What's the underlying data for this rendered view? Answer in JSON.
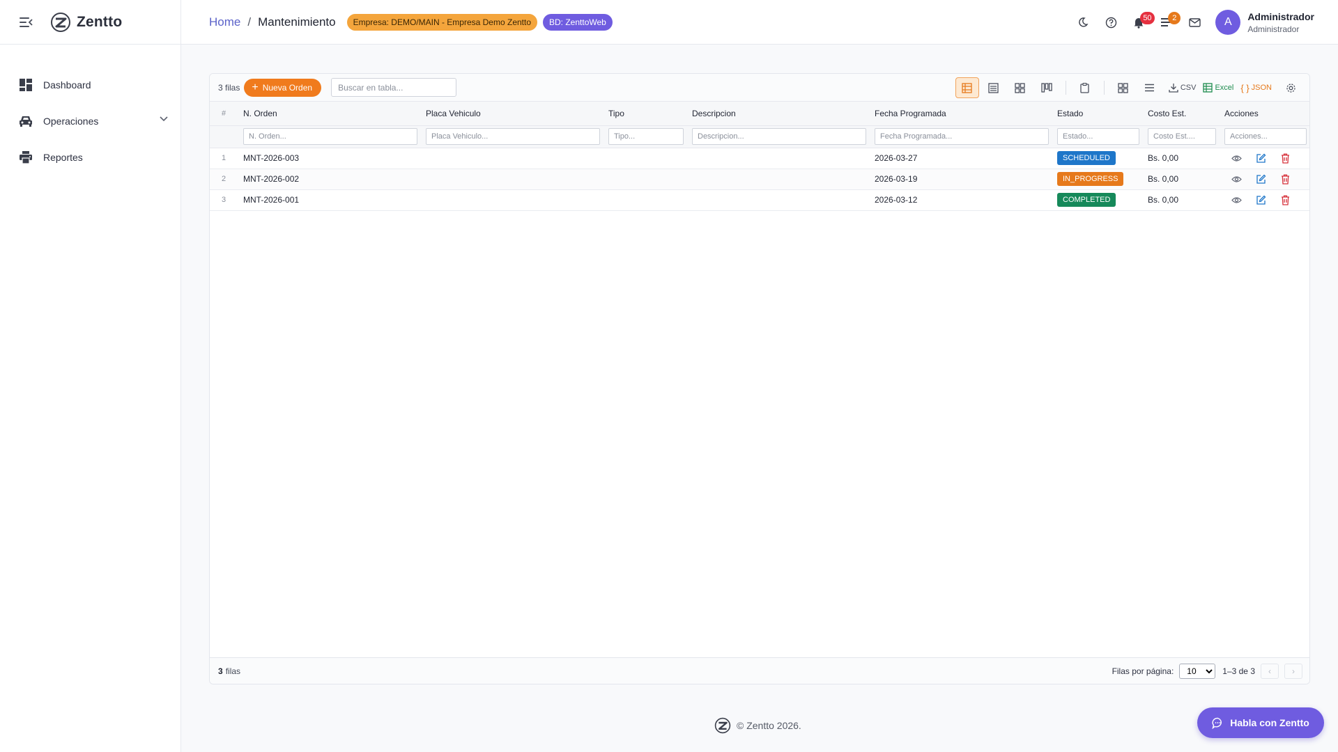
{
  "brand": {
    "name": "Zentto"
  },
  "sidebar": {
    "items": [
      {
        "label": "Dashboard"
      },
      {
        "label": "Operaciones"
      },
      {
        "label": "Reportes"
      }
    ]
  },
  "breadcrumb": {
    "home": "Home",
    "separator": "/",
    "current": "Mantenimiento"
  },
  "chips": {
    "empresa": "Empresa: DEMO/MAIN - Empresa Demo Zentto",
    "bd": "BD: ZenttoWeb"
  },
  "notifications": {
    "bell_count": "50",
    "tasks_count": "2"
  },
  "user": {
    "initial": "A",
    "name": "Administrador",
    "role": "Administrador"
  },
  "toolbar": {
    "rows_label": "3 filas",
    "new_button": "Nueva Orden",
    "search_placeholder": "Buscar en tabla...",
    "csv_label": "CSV",
    "excel_label": "Excel",
    "json_label": "JSON"
  },
  "table": {
    "columns": [
      "#",
      "N. Orden",
      "Placa Vehiculo",
      "Tipo",
      "Descripcion",
      "Fecha Programada",
      "Estado",
      "Costo Est.",
      "Acciones"
    ],
    "filters": [
      "N. Orden...",
      "Placa Vehiculo...",
      "Tipo...",
      "Descripcion...",
      "Fecha Programada...",
      "Estado...",
      "Costo Est....",
      "Acciones..."
    ],
    "rows": [
      {
        "idx": "1",
        "orden": "MNT-2026-003",
        "placa": "",
        "tipo": "",
        "descripcion": "",
        "fecha": "2026-03-27",
        "estado": "SCHEDULED",
        "estado_color": "#1e76c9",
        "costo": "Bs. 0,00"
      },
      {
        "idx": "2",
        "orden": "MNT-2026-002",
        "placa": "",
        "tipo": "",
        "descripcion": "",
        "fecha": "2026-03-19",
        "estado": "IN_PROGRESS",
        "estado_color": "#e6791b",
        "costo": "Bs. 0,00"
      },
      {
        "idx": "3",
        "orden": "MNT-2026-001",
        "placa": "",
        "tipo": "",
        "descripcion": "",
        "fecha": "2026-03-12",
        "estado": "COMPLETED",
        "estado_color": "#16895a",
        "costo": "Bs. 0,00"
      }
    ]
  },
  "footer": {
    "rows_count": "3",
    "rows_word": "filas",
    "rows_per_page_label": "Filas por página:",
    "rows_per_page": "10",
    "range": "1–3 de 3"
  },
  "copyright": "© Zentto 2026.",
  "chat_button": "Habla con Zentto",
  "colors": {
    "accent": "#6f5ce0",
    "orange": "#f07b1d",
    "link": "#5b62c9"
  }
}
